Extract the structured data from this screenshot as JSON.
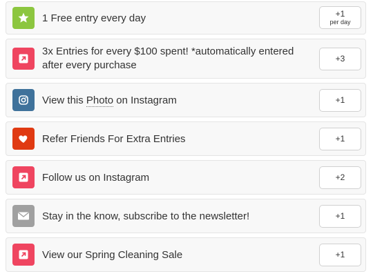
{
  "entries": [
    {
      "icon": "star-icon",
      "color": "#8cc63f",
      "label": "1 Free entry every day",
      "points": "+1",
      "sub": "per day"
    },
    {
      "icon": "external-link-icon",
      "color": "#ef4560",
      "label": "3x Entries for every $100 spent! *automatically entered after every purchase",
      "points": "+3"
    },
    {
      "icon": "instagram-icon",
      "color": "#3f729b",
      "label_pre": "View this ",
      "label_link": "Photo",
      "label_post": " on Instagram",
      "points": "+1"
    },
    {
      "icon": "heart-icon",
      "color": "#e03a12",
      "label": "Refer Friends For Extra Entries",
      "points": "+1"
    },
    {
      "icon": "external-link-icon",
      "color": "#ef4560",
      "label": "Follow us on Instagram",
      "points": "+2"
    },
    {
      "icon": "envelope-icon",
      "color": "#a0a0a0",
      "label": "Stay in the know, subscribe to the newsletter!",
      "points": "+1"
    },
    {
      "icon": "external-link-icon",
      "color": "#ef4560",
      "label": "View our Spring Cleaning Sale",
      "points": "+1"
    }
  ]
}
